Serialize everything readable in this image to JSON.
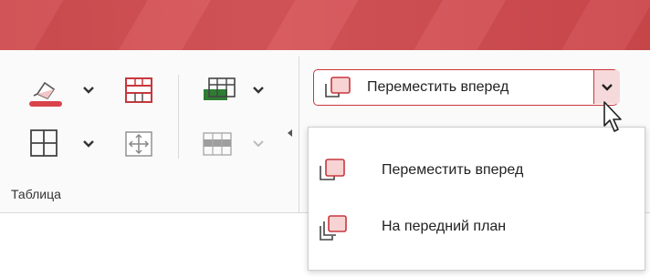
{
  "window": {
    "titlebar_color": "#d0494d"
  },
  "ribbon": {
    "group_table": {
      "label": "Таблица"
    },
    "arrange": {
      "main_button_label": "Переместить вперед",
      "dropdown_items": [
        {
          "label": "Переместить вперед",
          "icon": "bring-forward-icon"
        },
        {
          "label": "На передний план",
          "icon": "bring-to-front-icon"
        }
      ]
    }
  },
  "colors": {
    "accent": "#c8373c",
    "shading_bar": "#d9434a",
    "green_icon": "#2e7d32"
  }
}
